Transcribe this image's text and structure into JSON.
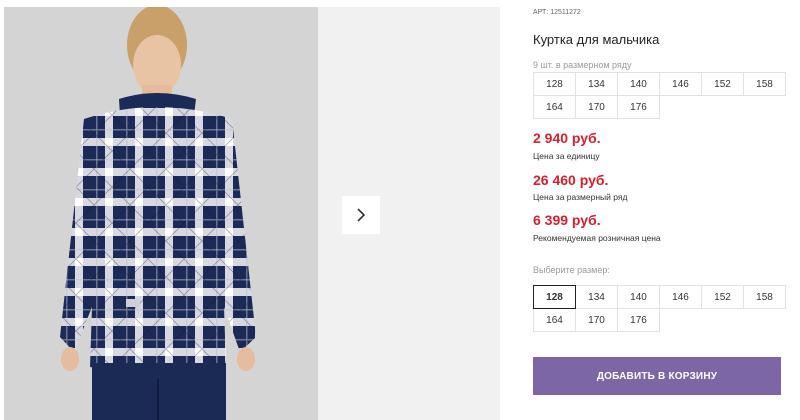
{
  "product": {
    "sku": "АРТ: 12511272",
    "title": "Куртка для мальчика",
    "row_note": "9 шт. в размерном ряду",
    "row_sizes": [
      "128",
      "134",
      "140",
      "146",
      "152",
      "158",
      "164",
      "170",
      "176"
    ],
    "prices": [
      {
        "value": "2 940 руб.",
        "label": "Цена за единицу"
      },
      {
        "value": "26 460 руб.",
        "label": "Цена за размерный ряд"
      },
      {
        "value": "6 399 руб.",
        "label": "Рекомендуемая розничная цена"
      }
    ],
    "select_label": "Выберите размер:",
    "select_sizes": [
      "128",
      "134",
      "140",
      "146",
      "152",
      "158",
      "164",
      "170",
      "176"
    ],
    "selected_size": "128",
    "cart_button": "ДОБАВИТЬ В КОРЗИНУ"
  },
  "gallery": {
    "next_icon": "chevron-right-icon"
  },
  "colors": {
    "price": "#d6202e",
    "button": "#7c66a5",
    "shirt_navy": "#1c2a57"
  }
}
